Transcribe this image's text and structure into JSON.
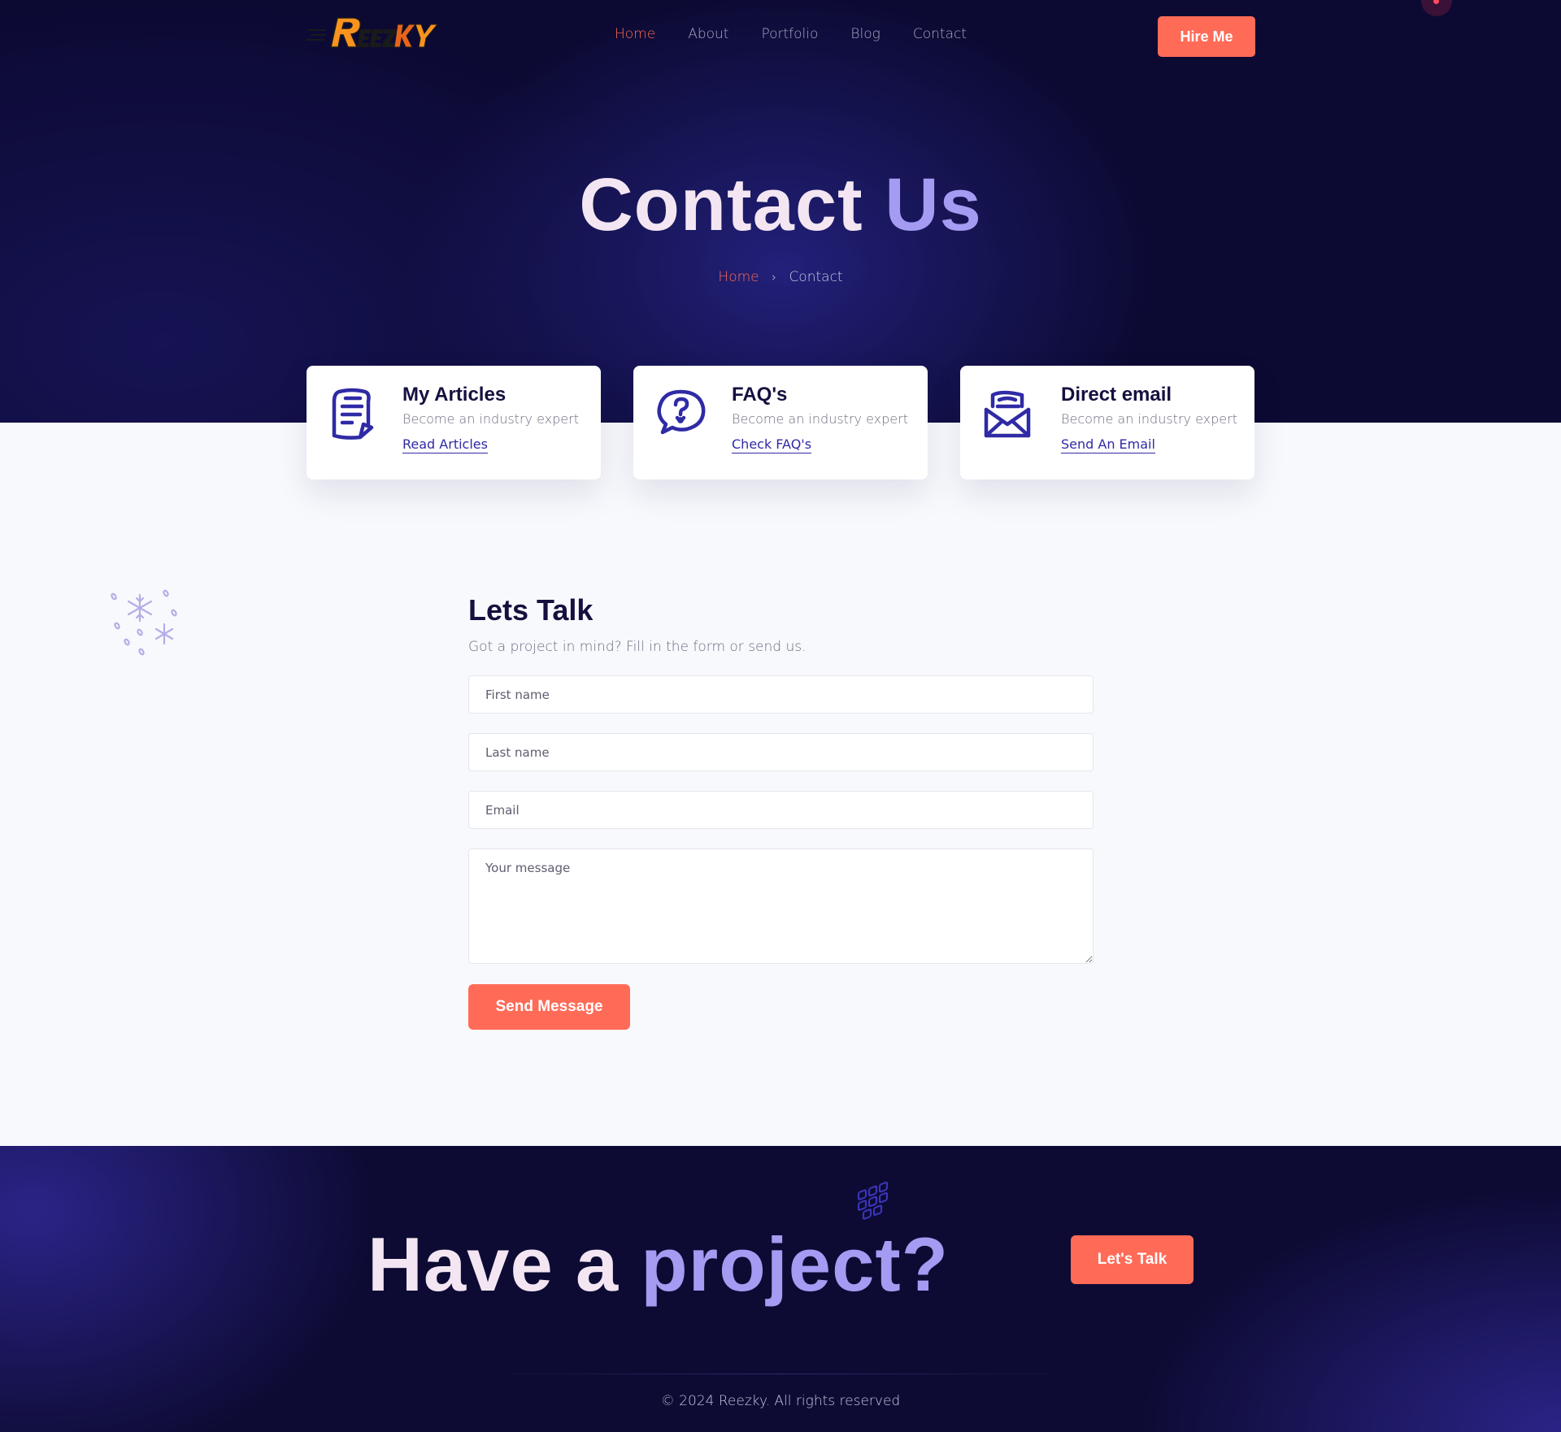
{
  "brand": {
    "logo_text": "REEZKY",
    "logo_colors": [
      "#f7931e",
      "#e8641b",
      "#1a1a1a"
    ]
  },
  "nav": {
    "items": [
      {
        "label": "Home",
        "active": true
      },
      {
        "label": "About"
      },
      {
        "label": "Portfolio"
      },
      {
        "label": "Blog"
      },
      {
        "label": "Contact"
      }
    ],
    "hire_label": "Hire Me"
  },
  "hero": {
    "title_part1": "Contact",
    "title_part2": "Us",
    "breadcrumb": {
      "home": "Home",
      "current": "Contact"
    }
  },
  "cards": [
    {
      "icon": "document-icon",
      "title": "My Articles",
      "subtitle": "Become an industry expert",
      "link": "Read Articles"
    },
    {
      "icon": "question-chat-icon",
      "title": "FAQ's",
      "subtitle": "Become an industry expert",
      "link": "Check FAQ's"
    },
    {
      "icon": "envelope-open-icon",
      "title": "Direct email",
      "subtitle": "Become an industry expert",
      "link": "Send An Email"
    }
  ],
  "form": {
    "title": "Lets Talk",
    "subtitle": "Got a project in mind? Fill in the form or send us.",
    "fields": {
      "first_name": {
        "placeholder": "First name",
        "value": ""
      },
      "last_name": {
        "placeholder": "Last name",
        "value": ""
      },
      "email": {
        "placeholder": "Email",
        "value": ""
      },
      "message": {
        "placeholder": "Your message",
        "value": ""
      }
    },
    "submit_label": "Send Message"
  },
  "footer": {
    "cta_part1": "Have a",
    "cta_part2": "project?",
    "cta_button": "Let's Talk",
    "copyright": "© 2024 Reezky. All rights reserved"
  },
  "colors": {
    "accent": "#ff6b57",
    "hero_bg": "#0c0a33",
    "title_light": "#f3e6f2",
    "title_purple": "#a49bf2",
    "icon_blue": "#2f2aa5",
    "page_bg": "#f8f9fd"
  }
}
